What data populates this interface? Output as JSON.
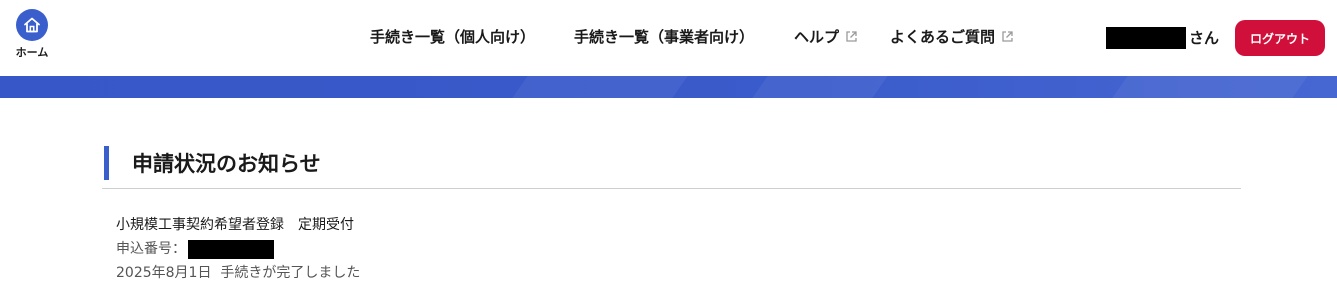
{
  "header": {
    "home_label": "ホーム",
    "nav": [
      {
        "label": "手続き一覧（個人向け）",
        "external": false
      },
      {
        "label": "手続き一覧（事業者向け）",
        "external": false
      },
      {
        "label": "ヘルプ",
        "external": true
      },
      {
        "label": "よくあるご質問",
        "external": true
      }
    ],
    "user_suffix": "さん",
    "logout_label": "ログアウト"
  },
  "main": {
    "section_title": "申請状況のお知らせ",
    "notice": {
      "title": "小規模工事契約希望者登録　定期受付",
      "app_number_label": "申込番号：",
      "status": "2025年8月1日  手続きが完了しました"
    }
  },
  "colors": {
    "accent": "#3a5fcd",
    "logout": "#d0103a"
  }
}
